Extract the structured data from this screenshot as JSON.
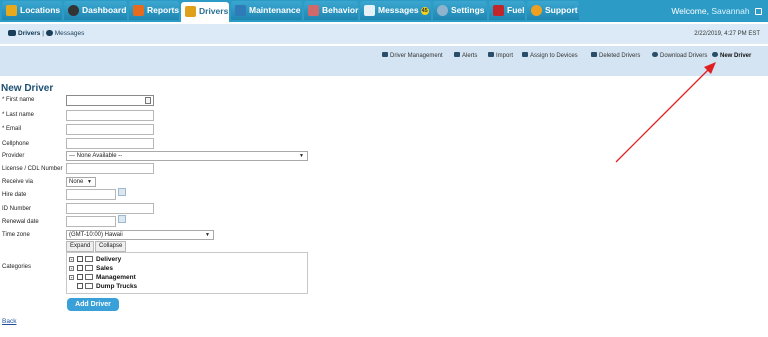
{
  "nav": {
    "tabs": [
      {
        "label": "Locations",
        "icon": "location-icon",
        "color": "#e8a91c"
      },
      {
        "label": "Dashboard",
        "icon": "gauge-icon",
        "color": "#333333"
      },
      {
        "label": "Reports",
        "icon": "report-icon",
        "color": "#e56c1f"
      },
      {
        "label": "Drivers",
        "icon": "driver-icon",
        "color": "#e0a11a"
      },
      {
        "label": "Maintenance",
        "icon": "wrench-icon",
        "color": "#2e7bb7"
      },
      {
        "label": "Behavior",
        "icon": "behavior-icon",
        "color": "#d06a6a"
      },
      {
        "label": "Messages",
        "icon": "mail-icon",
        "color": "#e6f0f7",
        "badge": "45"
      },
      {
        "label": "Settings",
        "icon": "gear-icon",
        "color": "#8fb3cc"
      },
      {
        "label": "Fuel",
        "icon": "fuel-icon",
        "color": "#c0262a"
      },
      {
        "label": "Support",
        "icon": "support-icon",
        "color": "#f0a020"
      }
    ],
    "active_tab": "Drivers",
    "welcome_prefix": "Welcome,",
    "user_name": "Savannah"
  },
  "subbar": {
    "section": "Drivers",
    "separator": " | ",
    "messages_link": "Messages",
    "timestamp": "2/22/2019, 4:27 PM EST"
  },
  "toolbar": {
    "items": [
      {
        "label": "Driver Management",
        "icon": "people-icon"
      },
      {
        "label": "Alerts",
        "icon": "flag-icon"
      },
      {
        "label": "Import",
        "icon": "upload-icon"
      },
      {
        "label": "Assign to Devices",
        "icon": "swap-icon"
      },
      {
        "label": "Deleted Drivers",
        "icon": "user-minus-icon"
      },
      {
        "label": "Download Drivers",
        "icon": "download-icon"
      },
      {
        "label": "New Driver",
        "icon": "plus-circle-icon"
      }
    ]
  },
  "form": {
    "title": "New Driver",
    "labels": {
      "first_name": "* First name",
      "last_name": "* Last name",
      "email": "* Email",
      "cellphone": "Cellphone",
      "provider": "Provider",
      "license": "License / CDL Number",
      "receive_via": "Receive via",
      "hire_date": "Hire date",
      "id_number": "ID Number",
      "renewal_date": "Renewal date",
      "time_zone": "Time zone",
      "categories": "Categories"
    },
    "provider_value": "--- None Available --",
    "receive_via_value": "None",
    "time_zone_value": "(GMT-10:00) Hawaii",
    "expand_label": "Expand",
    "collapse_label": "Collapse",
    "categories": [
      "Delivery",
      "Sales",
      "Management",
      "Dump Trucks"
    ],
    "submit_label": "Add Driver",
    "back_label": "Back"
  },
  "colors": {
    "nav_bg": "#2c9cc7",
    "subbar_bg": "#dbeaf6",
    "toolbar_bg": "#d4e4f3",
    "accent_button": "#3aa0d8",
    "annotation_arrow": "#e02020"
  }
}
